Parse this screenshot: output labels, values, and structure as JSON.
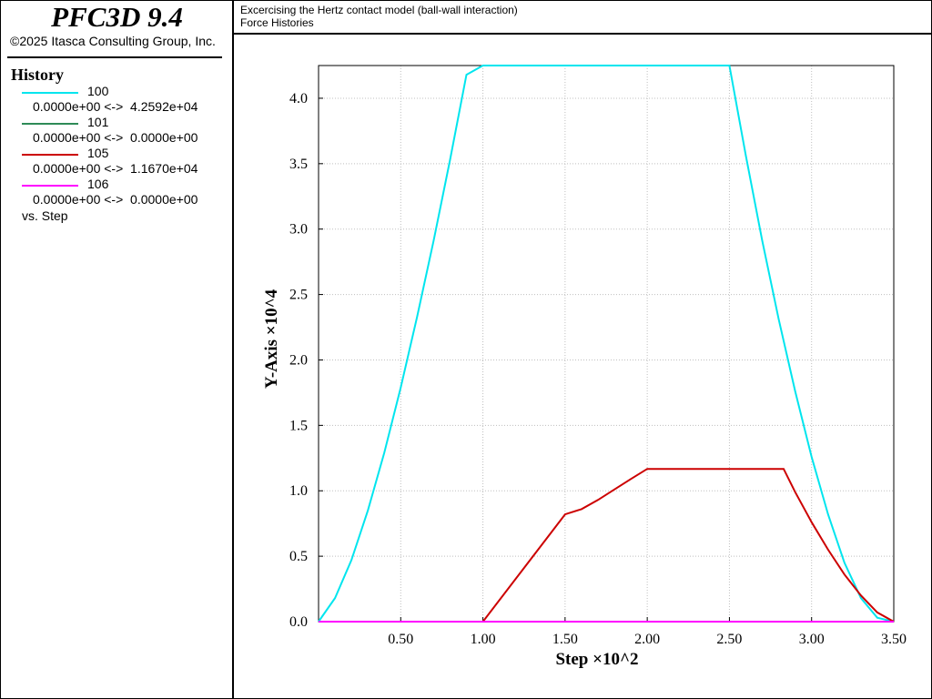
{
  "left_panel": {
    "app_title": "PFC3D 9.4",
    "copyright": "©2025 Itasca Consulting Group, Inc.",
    "history_heading": "History",
    "legend": [
      {
        "id": "100",
        "range": "0.0000e+00 <->  4.2592e+04",
        "color": "#00e5ee"
      },
      {
        "id": "101",
        "range": "0.0000e+00 <->  0.0000e+00",
        "color": "#2e8b57"
      },
      {
        "id": "105",
        "range": "0.0000e+00 <->  1.1670e+04",
        "color": "#cc0000"
      },
      {
        "id": "106",
        "range": "0.0000e+00 <->  0.0000e+00",
        "color": "#ff00ff"
      }
    ],
    "vs_label": "vs. Step"
  },
  "header": {
    "line1": "Excercising the Hertz contact model (ball-wall interaction)",
    "line2": "Force Histories"
  },
  "chart_data": {
    "type": "line",
    "xlabel": "Step ×10^2",
    "ylabel": "Y-Axis ×10^4",
    "xlim": [
      0,
      3.5
    ],
    "ylim": [
      0,
      4.25
    ],
    "xticks": [
      0.5,
      1.0,
      1.5,
      2.0,
      2.5,
      3.0,
      3.5
    ],
    "xtick_labels": [
      "0.50",
      "1.00",
      "1.50",
      "2.00",
      "2.50",
      "3.00",
      "3.50"
    ],
    "yticks": [
      0,
      0.5,
      1.0,
      1.5,
      2.0,
      2.5,
      3.0,
      3.5,
      4.0
    ],
    "ytick_labels": [
      "0.0",
      "0.5",
      "1.0",
      "1.5",
      "2.0",
      "2.5",
      "3.0",
      "3.5",
      "4.0"
    ],
    "grid": true,
    "series": [
      {
        "name": "100",
        "color": "#00e5ee",
        "x": [
          0,
          0.1,
          0.2,
          0.3,
          0.4,
          0.5,
          0.6,
          0.7,
          0.8,
          0.9,
          1.0,
          2.5,
          2.6,
          2.7,
          2.8,
          2.9,
          3.0,
          3.1,
          3.2,
          3.3,
          3.4,
          3.5
        ],
        "y": [
          0,
          0.18,
          0.47,
          0.85,
          1.29,
          1.79,
          2.33,
          2.91,
          3.53,
          4.18,
          4.26,
          4.26,
          3.56,
          2.91,
          2.31,
          1.76,
          1.26,
          0.82,
          0.45,
          0.18,
          0.03,
          0
        ]
      },
      {
        "name": "101",
        "color": "#2e8b57",
        "x": [
          0,
          3.5
        ],
        "y": [
          0,
          0
        ]
      },
      {
        "name": "105",
        "color": "#cc0000",
        "x": [
          0,
          1.0,
          1.25,
          1.5,
          1.6,
          1.7,
          1.8,
          1.9,
          2.0,
          2.83,
          2.9,
          3.0,
          3.1,
          3.2,
          3.3,
          3.4,
          3.5
        ],
        "y": [
          0,
          0,
          0.41,
          0.82,
          0.86,
          0.93,
          1.01,
          1.09,
          1.167,
          1.167,
          0.99,
          0.76,
          0.55,
          0.36,
          0.2,
          0.07,
          0
        ]
      },
      {
        "name": "106",
        "color": "#ff00ff",
        "x": [
          0,
          3.5
        ],
        "y": [
          0,
          0
        ]
      }
    ]
  }
}
